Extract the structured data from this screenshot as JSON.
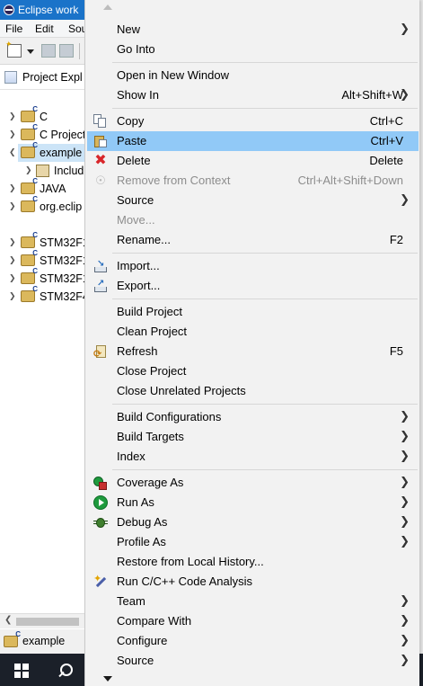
{
  "window": {
    "title": "Eclipse work",
    "menubar": [
      "File",
      "Edit",
      "Sou"
    ]
  },
  "project_explorer": {
    "tab_label": "Project Expl",
    "items": [
      {
        "label": "C",
        "expanded": false
      },
      {
        "label": "C Project",
        "expanded": false
      },
      {
        "label": "example",
        "expanded": true,
        "selected": true
      },
      {
        "label": "Includ",
        "child": true
      },
      {
        "label": "JAVA",
        "expanded": false
      },
      {
        "label": "org.eclip",
        "expanded": false
      },
      {
        "label": "STM32F1",
        "expanded": false
      },
      {
        "label": "STM32F1",
        "expanded": false
      },
      {
        "label": "STM32F1",
        "expanded": false
      },
      {
        "label": "STM32F4",
        "expanded": false
      }
    ]
  },
  "status_bar": {
    "selected_project": "example"
  },
  "context_menu": {
    "groups": [
      [
        {
          "label": "New",
          "submenu": true
        },
        {
          "label": "Go Into"
        }
      ],
      [
        {
          "label": "Open in New Window"
        },
        {
          "label": "Show In",
          "shortcut": "Alt+Shift+W",
          "submenu": true
        }
      ],
      [
        {
          "label": "Copy",
          "shortcut": "Ctrl+C",
          "icon": "copy-icon"
        },
        {
          "label": "Paste",
          "shortcut": "Ctrl+V",
          "icon": "paste-icon",
          "hover": true
        },
        {
          "label": "Delete",
          "shortcut": "Delete",
          "icon": "delete-icon"
        },
        {
          "label": "Remove from Context",
          "shortcut": "Ctrl+Alt+Shift+Down",
          "icon": "remove-context-icon",
          "disabled": true
        },
        {
          "label": "Source",
          "submenu": true
        },
        {
          "label": "Move...",
          "disabled": true
        },
        {
          "label": "Rename...",
          "shortcut": "F2"
        }
      ],
      [
        {
          "label": "Import...",
          "icon": "import-icon"
        },
        {
          "label": "Export...",
          "icon": "export-icon"
        }
      ],
      [
        {
          "label": "Build Project"
        },
        {
          "label": "Clean Project"
        },
        {
          "label": "Refresh",
          "shortcut": "F5",
          "icon": "refresh-icon"
        },
        {
          "label": "Close Project"
        },
        {
          "label": "Close Unrelated Projects"
        }
      ],
      [
        {
          "label": "Build Configurations",
          "submenu": true
        },
        {
          "label": "Build Targets",
          "submenu": true
        },
        {
          "label": "Index",
          "submenu": true
        }
      ],
      [
        {
          "label": "Coverage As",
          "submenu": true,
          "icon": "coverage-icon"
        },
        {
          "label": "Run As",
          "submenu": true,
          "icon": "run-icon"
        },
        {
          "label": "Debug As",
          "submenu": true,
          "icon": "debug-icon"
        },
        {
          "label": "Profile As",
          "submenu": true
        },
        {
          "label": "Restore from Local History..."
        },
        {
          "label": "Run C/C++ Code Analysis",
          "icon": "code-analysis-icon"
        },
        {
          "label": "Team",
          "submenu": true
        },
        {
          "label": "Compare With",
          "submenu": true
        },
        {
          "label": "Configure",
          "submenu": true
        },
        {
          "label": "Source",
          "submenu": true
        }
      ]
    ]
  },
  "colors": {
    "menu_bg": "#f2f2f2",
    "hover_bg": "#91c9f7",
    "disabled_text": "#8d8d8d",
    "titlebar": "#1a73c9",
    "taskbar": "#1b2029"
  }
}
